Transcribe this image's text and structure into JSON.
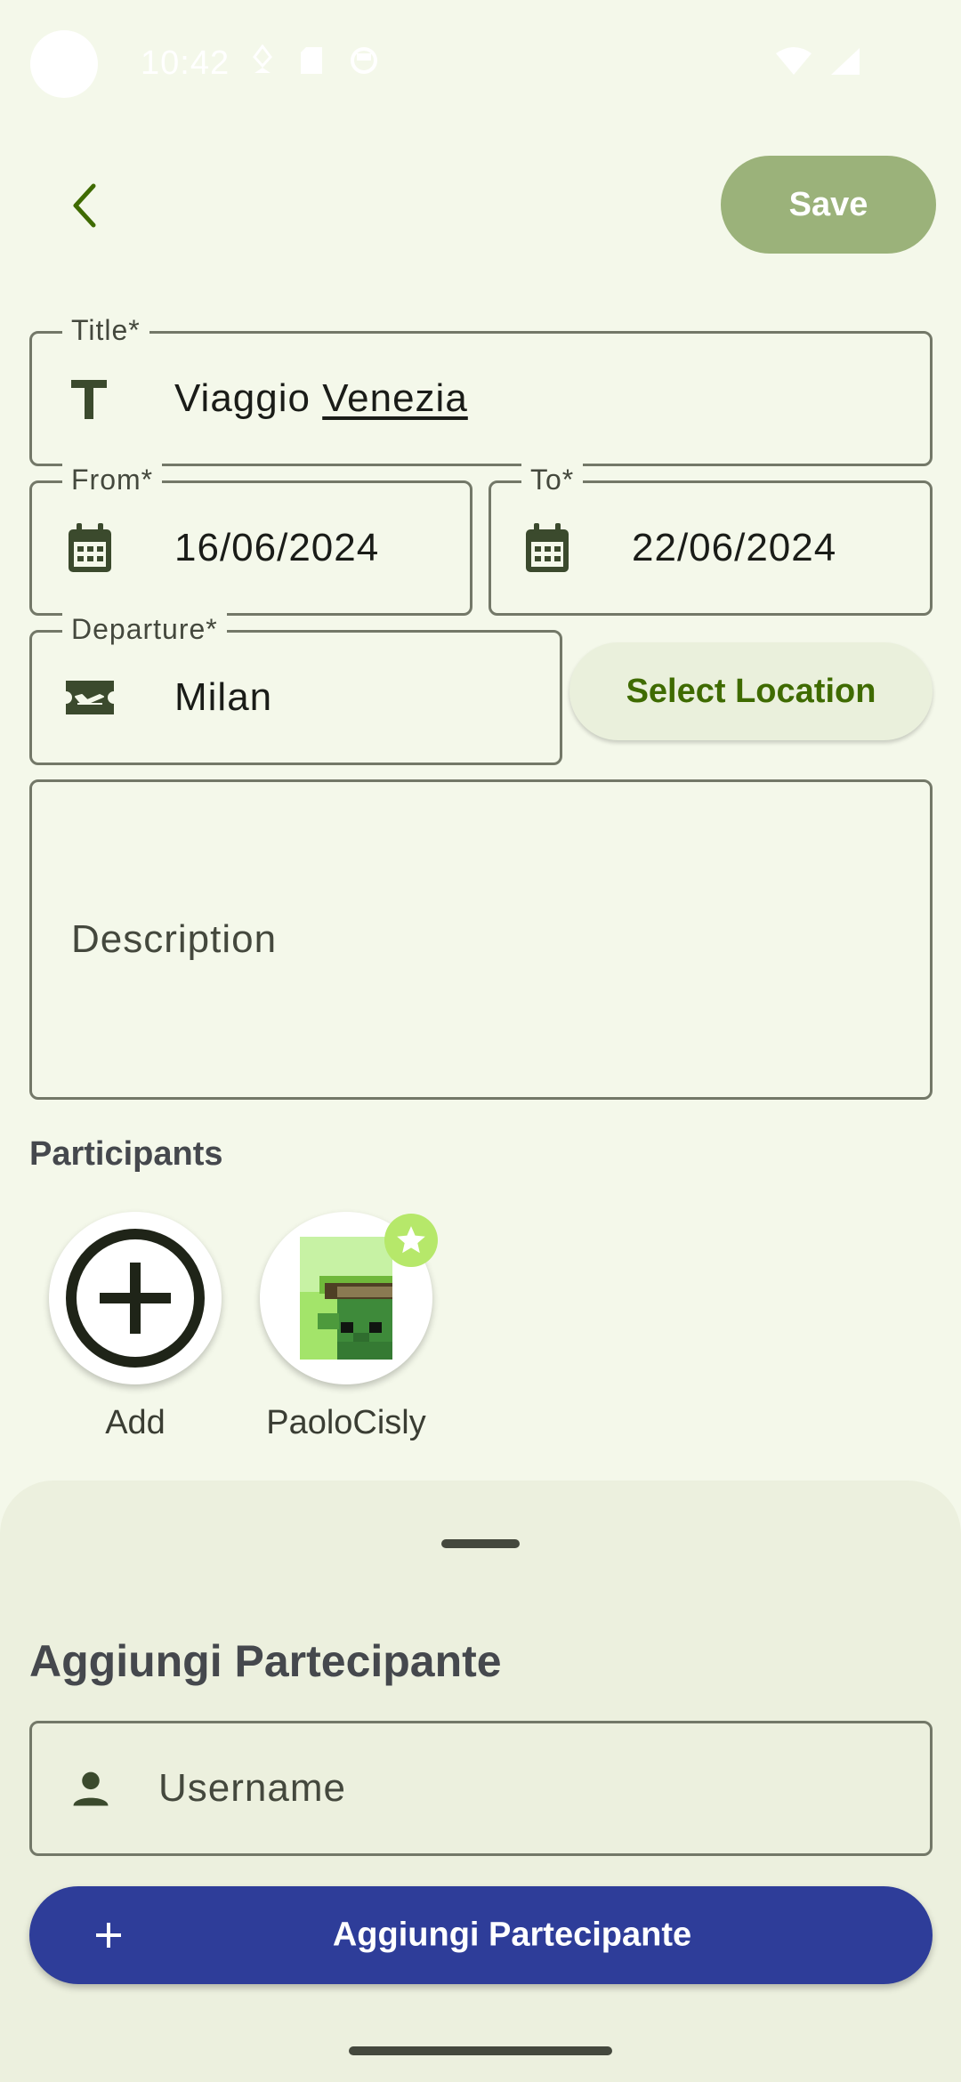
{
  "status_bar": {
    "time": "10:42"
  },
  "toolbar": {
    "save_label": "Save"
  },
  "form": {
    "title": {
      "label": "Title*",
      "value_plain": "Viaggio ",
      "value_underlined": "Venezia"
    },
    "from": {
      "label": "From*",
      "value": "16/06/2024"
    },
    "to": {
      "label": "To*",
      "value": "22/06/2024"
    },
    "departure": {
      "label": "Departure*",
      "value": "Milan"
    },
    "select_location_label": "Select Location",
    "description_placeholder": "Description"
  },
  "participants": {
    "title": "Participants",
    "add_label": "Add",
    "items": [
      {
        "name": "PaoloCisly",
        "is_owner": true
      }
    ]
  },
  "sheet": {
    "title": "Aggiungi Partecipante",
    "username_placeholder": "Username",
    "button_label": "Aggiungi Partecipante"
  },
  "colors": {
    "background": "#f4f8ea",
    "save_button": "#9bb27a",
    "primary_button": "#2e3d99",
    "accent_text": "#3f6b00",
    "badge": "#b6e86a"
  },
  "icons": {
    "back": "chevron-left-icon",
    "title_field": "text-format-icon",
    "date_fields": "calendar-icon",
    "departure_field": "airplane-ticket-icon",
    "add_participant": "add-circle-icon",
    "owner_badge": "star-icon",
    "username_field": "person-icon",
    "add_button": "plus-icon"
  }
}
